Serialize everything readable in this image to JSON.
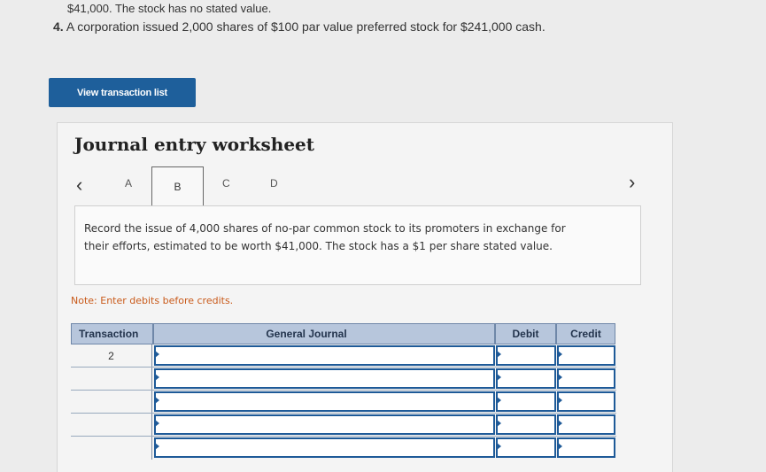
{
  "question": {
    "line1": "$41,000. The stock has no stated value.",
    "number": "4.",
    "line2": "A corporation issued 2,000 shares of $100 par value preferred stock for $241,000 cash."
  },
  "view_button": "View transaction list",
  "worksheet": {
    "title": "Journal entry worksheet",
    "tabs": [
      "A",
      "B",
      "C",
      "D"
    ],
    "active_tab": "B",
    "description": "Record the issue of 4,000 shares of no-par common stock to its promoters in exchange for their efforts, estimated to be worth $41,000. The stock has a $1 per share stated value.",
    "note": "Note: Enter debits before credits."
  },
  "table": {
    "headers": {
      "transaction": "Transaction",
      "general_journal": "General Journal",
      "debit": "Debit",
      "credit": "Credit"
    },
    "rows": [
      {
        "transaction": "2"
      },
      {
        "transaction": ""
      },
      {
        "transaction": ""
      },
      {
        "transaction": ""
      },
      {
        "transaction": ""
      }
    ]
  },
  "colors": {
    "button": "#1e5f9b",
    "header": "#b7c6dc",
    "input_border": "#1e5a98",
    "note": "#c95a1a"
  }
}
